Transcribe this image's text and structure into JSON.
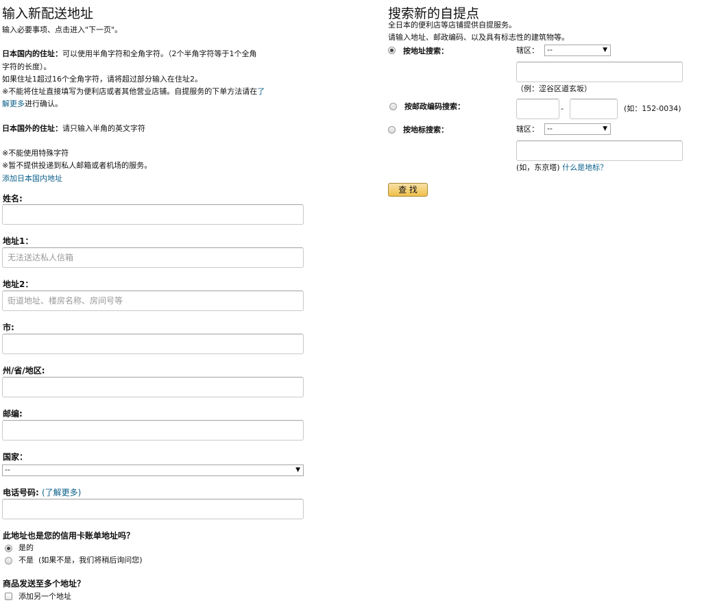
{
  "left": {
    "title": "输入新配送地址",
    "intro": "输入必要事项、点击进入\"下一页\"。",
    "domestic": {
      "heading": "日本国内的住址：",
      "line1_rest": "可以使用半角字符和全角字符。（2个半角字符等于1个全角",
      "line2": "字符的长度）。",
      "line3": "如果住址1超过16个全角字符，请将超过部分输入在住址2。",
      "line4_start": "※不能将住址直接填写为便利店或者其他营业店铺。自提服务的下单方法请在",
      "link_part1": "了",
      "link_part2": "解更多",
      "line5_rest": "进行确认。"
    },
    "foreign": {
      "heading": "日本国外的住址：",
      "rest": "请只输入半角的英文字符"
    },
    "note1": "※不能使用特殊字符",
    "note2": "※暂不提供投递到私人邮箱或者机场的服务。",
    "add_domestic_link": "添加日本国内地址",
    "fields": {
      "name_label": "姓名:",
      "name_value": "",
      "address1_label": "地址1：",
      "address1_placeholder": "无法送达私人信箱",
      "address2_label": "地址2：",
      "address2_placeholder": "街道地址、楼房名称、房间号等",
      "city_label": "市:",
      "city_value": "",
      "state_label": "州/省/地区:",
      "state_value": "",
      "postal_label": "邮编:",
      "postal_value": "",
      "country_label": "国家：",
      "country_selected": "--",
      "phone_label": "电话号码:",
      "phone_link": "(了解更多)",
      "phone_value": ""
    },
    "billing": {
      "question": "此地址也是您的信用卡账单地址吗？",
      "yes": "是的",
      "no": "不是",
      "no_note": "(如果不是，我们将稍后询问您)",
      "selected": "yes"
    },
    "multi": {
      "question": "商品发送至多个地址？",
      "add_another": "添加另一个地址"
    }
  },
  "right": {
    "title": "搜索新的自提点",
    "desc1": "全日本的便利店等店铺提供自提服务。",
    "desc2": "请输入地址、邮政编码、以及具有标志性的建筑物等。",
    "by_address": {
      "label": "按地址搜索：",
      "district_label": "辖区：",
      "district_selected": "--",
      "example": "（例：涩谷区道玄坂）",
      "selected": true
    },
    "by_postal": {
      "label": "按邮政编码搜索：",
      "separator": "-",
      "example": "(如：152-0034)"
    },
    "by_landmark": {
      "label": "按地标搜索：",
      "district_label": "辖区：",
      "district_selected": "--",
      "example": "(如，东京塔)",
      "link": "什么是地标？"
    },
    "search_button": "查 找"
  }
}
